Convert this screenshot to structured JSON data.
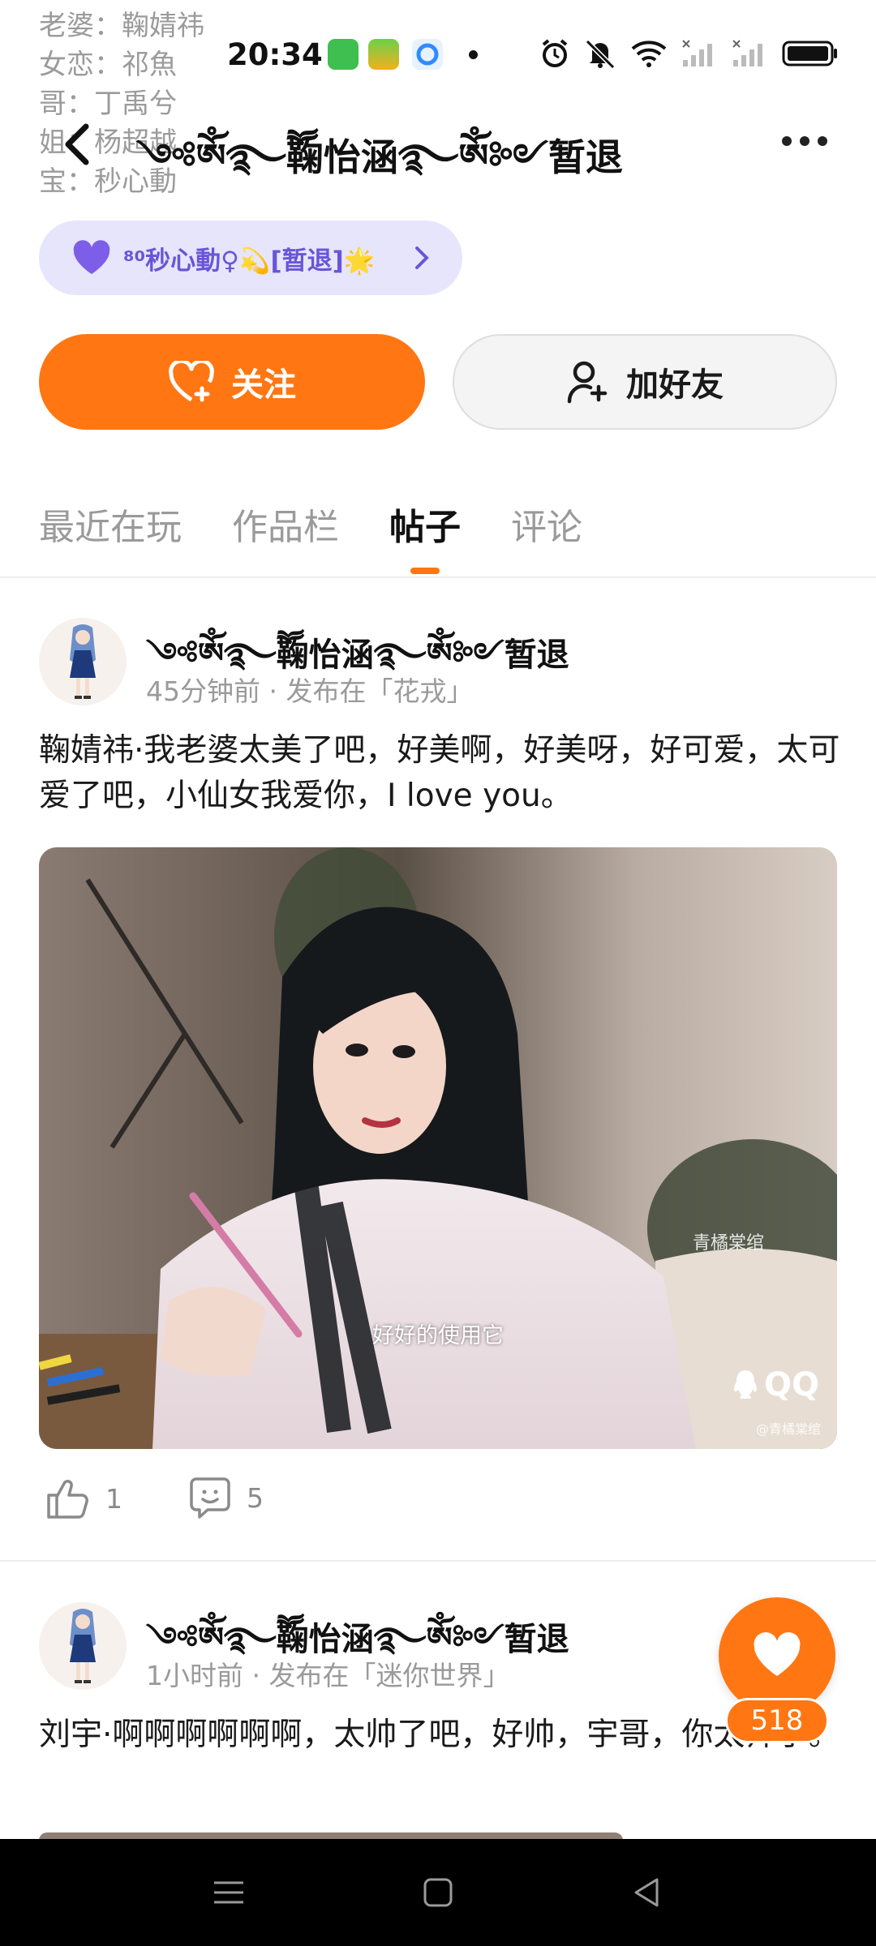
{
  "status_bar": {
    "time": "20:34",
    "icons": [
      "app-green-icon",
      "app-game-icon",
      "app-browser-icon",
      "notification-dot",
      "alarm-icon",
      "mute-icon",
      "wifi-icon",
      "signal-1-icon",
      "signal-2-icon",
      "battery-icon"
    ]
  },
  "bio_lines": [
    "老婆：鞠婧祎",
    "女恋：祁魚",
    "哥：丁禹兮",
    "姐：杨超越",
    "宝：秒心動"
  ],
  "header": {
    "title": "༺ༀ࿐ཽ鞠怡涵࿐ༀ༻暂退"
  },
  "badge": {
    "text": "⁸⁰秒心動♀💫[暂退]🌟"
  },
  "buttons": {
    "follow_label": "关注",
    "add_friend_label": "加好友"
  },
  "tabs": [
    {
      "label": "最近在玩",
      "active": false
    },
    {
      "label": "作品栏",
      "active": false
    },
    {
      "label": "帖子",
      "active": true
    },
    {
      "label": "评论",
      "active": false
    }
  ],
  "posts": [
    {
      "author": "༺ༀ࿐ཽ鞠怡涵࿐ༀ༻暂退",
      "meta": "45分钟前 · 发布在「花戎」",
      "body": "鞠婧祎·我老婆太美了吧，好美啊，好美呀，好可爱，太可爱了吧，小仙女我爱你，I love you。",
      "image": {
        "caption": "好好的使用它",
        "watermark": "青橘棠绾",
        "brand": "QQ",
        "handle": "@青橘棠绾"
      },
      "likes": "1",
      "comments": "5"
    },
    {
      "author": "༺ༀ࿐ཽ鞠怡涵࿐ༀ༻暂退",
      "meta": "1小时前 · 发布在「迷你世界」",
      "body": "刘宇·啊啊啊啊啊啊，太帅了吧，好帅，宇哥，你太帅了。"
    }
  ],
  "floating_like": {
    "count": "518"
  },
  "colors": {
    "accent": "#ff7612",
    "badge_bg": "#e7e5fb",
    "badge_text": "#6a55d8"
  }
}
